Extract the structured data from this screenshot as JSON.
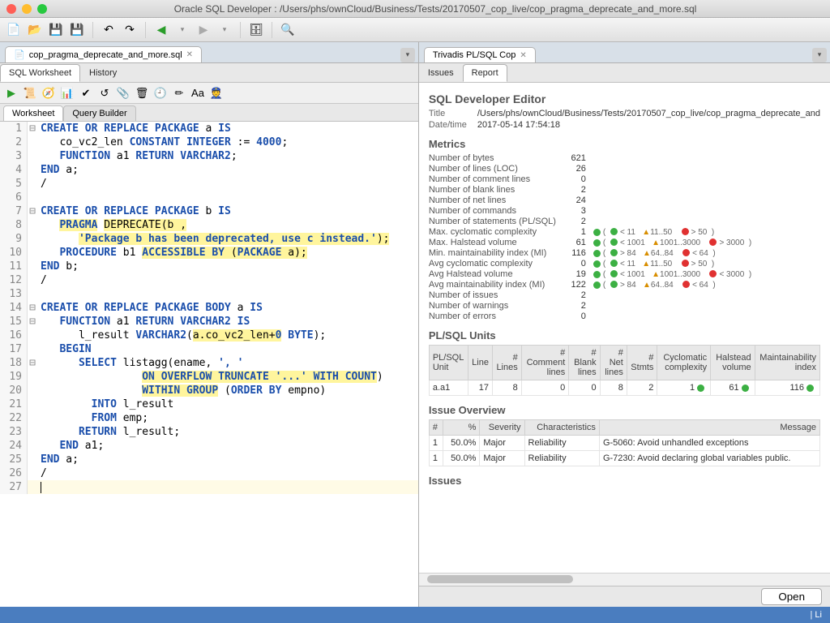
{
  "window": {
    "title": "Oracle SQL Developer : /Users/phs/ownCloud/Business/Tests/20170507_cop_live/cop_pragma_deprecate_and_more.sql"
  },
  "left": {
    "file_tab": "cop_pragma_deprecate_and_more.sql",
    "subtabs": {
      "sql": "SQL Worksheet",
      "history": "History"
    },
    "ws_tabs": {
      "worksheet": "Worksheet",
      "qb": "Query Builder"
    },
    "code": [
      {
        "n": 1,
        "f": "⊟",
        "html": "<span class='kw'>CREATE OR REPLACE PACKAGE</span> a <span class='kw'>IS</span>"
      },
      {
        "n": 2,
        "f": "",
        "html": "   co_vc2_len <span class='kw'>CONSTANT INTEGER</span> := <span class='num'>4000</span>;"
      },
      {
        "n": 3,
        "f": "",
        "html": "   <span class='kw'>FUNCTION</span> a1 <span class='kw'>RETURN VARCHAR2</span>;"
      },
      {
        "n": 4,
        "f": "",
        "html": "<span class='kw'>END</span> a;"
      },
      {
        "n": 5,
        "f": "",
        "html": "/"
      },
      {
        "n": 6,
        "f": "",
        "html": ""
      },
      {
        "n": 7,
        "f": "⊟",
        "html": "<span class='kw'>CREATE OR REPLACE PACKAGE</span> b <span class='kw'>IS</span>"
      },
      {
        "n": 8,
        "f": "",
        "html": "   <span class='hl'><span class='kw'>PRAGMA</span></span> <span class='hl'>DEPRECATE(b ,</span>"
      },
      {
        "n": 9,
        "f": "",
        "html": "      <span class='hl'><span class='str'>'Package b has been deprecated, use c instead.'</span>);</span>"
      },
      {
        "n": 10,
        "f": "",
        "html": "   <span class='kw'>PROCEDURE</span> b1 <span class='hl'><span class='kw'>ACCESSIBLE BY</span> (<span class='kw'>PACKAGE</span> a);</span>"
      },
      {
        "n": 11,
        "f": "",
        "html": "<span class='kw'>END</span> b;"
      },
      {
        "n": 12,
        "f": "",
        "html": "/"
      },
      {
        "n": 13,
        "f": "",
        "html": ""
      },
      {
        "n": 14,
        "f": "⊟",
        "html": "<span class='kw'>CREATE OR REPLACE PACKAGE BODY</span> a <span class='kw'>IS</span>"
      },
      {
        "n": 15,
        "f": "⊟",
        "html": "   <span class='kw'>FUNCTION</span> a1 <span class='kw'>RETURN VARCHAR2 IS</span>"
      },
      {
        "n": 16,
        "f": "",
        "html": "      l_result <span class='kw'>VARCHAR2</span>(<span class='hl'>a.co_vc2_len+<span class='num'>0</span></span> <span class='kw'>BYTE</span>);"
      },
      {
        "n": 17,
        "f": "",
        "html": "   <span class='kw'>BEGIN</span>"
      },
      {
        "n": 18,
        "f": "⊟",
        "html": "      <span class='kw'>SELECT</span> listagg(ename, <span class='str'>', '</span>"
      },
      {
        "n": 19,
        "f": "",
        "html": "                <span class='hl'><span class='kw'>ON OVERFLOW TRUNCATE</span> <span class='str'>'...'</span> <span class='kw'>WITH COUNT</span></span>)"
      },
      {
        "n": 20,
        "f": "",
        "html": "                <span class='hl'><span class='kw'>WITHIN GROUP</span></span> (<span class='kw'>ORDER BY</span> empno)"
      },
      {
        "n": 21,
        "f": "",
        "html": "        <span class='kw'>INTO</span> l_result"
      },
      {
        "n": 22,
        "f": "",
        "html": "        <span class='kw'>FROM</span> emp;"
      },
      {
        "n": 23,
        "f": "",
        "html": "      <span class='kw'>RETURN</span> l_result;"
      },
      {
        "n": 24,
        "f": "",
        "html": "   <span class='kw'>END</span> a1;"
      },
      {
        "n": 25,
        "f": "",
        "html": "<span class='kw'>END</span> a;"
      },
      {
        "n": 26,
        "f": "",
        "html": "/"
      },
      {
        "n": 27,
        "f": "",
        "html": "<span class='cursor'></span>",
        "cur": true
      }
    ]
  },
  "right": {
    "tab_title": "Trivadis PL/SQL Cop",
    "subtabs": {
      "issues": "Issues",
      "report": "Report"
    },
    "report": {
      "heading": "SQL Developer Editor",
      "title_label": "Title",
      "title_value": "/Users/phs/ownCloud/Business/Tests/20170507_cop_live/cop_pragma_deprecate_and",
      "dt_label": "Date/time",
      "dt_value": "2017-05-14 17:54:18",
      "metrics_heading": "Metrics",
      "simple_metrics": [
        {
          "label": "Number of bytes",
          "val": "621"
        },
        {
          "label": "Number of lines (LOC)",
          "val": "26"
        },
        {
          "label": "Number of comment lines",
          "val": "0"
        },
        {
          "label": "Number of blank lines",
          "val": "2"
        },
        {
          "label": "Number of net lines",
          "val": "24"
        },
        {
          "label": "Number of commands",
          "val": "3"
        },
        {
          "label": "Number of statements (PL/SQL)",
          "val": "2"
        }
      ],
      "threshold_metrics": [
        {
          "label": "Max. cyclomatic complexity",
          "val": "1",
          "g": "< 11",
          "y": "11..50",
          "r": "> 50"
        },
        {
          "label": "Max. Halstead volume",
          "val": "61",
          "g": "< 1001",
          "y": "1001..3000",
          "r": "> 3000"
        },
        {
          "label": "Min. maintainability index (MI)",
          "val": "116",
          "g": "> 84",
          "y": "64..84",
          "r": "< 64"
        },
        {
          "label": "Avg cyclomatic complexity",
          "val": "0",
          "g": "< 11",
          "y": "11..50",
          "r": "> 50"
        },
        {
          "label": "Avg Halstead volume",
          "val": "19",
          "g": "< 1001",
          "y": "1001..3000",
          "r": "< 3000"
        },
        {
          "label": "Avg maintainability index (MI)",
          "val": "122",
          "g": "> 84",
          "y": "64..84",
          "r": "< 64"
        }
      ],
      "tail_metrics": [
        {
          "label": "Number of issues",
          "val": "2"
        },
        {
          "label": "Number of warnings",
          "val": "2"
        },
        {
          "label": "Number of errors",
          "val": "0"
        }
      ],
      "units_heading": "PL/SQL Units",
      "units_headers": [
        "PL/SQL Unit",
        "Line",
        "# Lines",
        "# Comment lines",
        "# Blank lines",
        "# Net lines",
        "# Stmts",
        "Cyclomatic complexity",
        "Halstead volume",
        "Maintainability index"
      ],
      "units_row": [
        "a.a1",
        "17",
        "8",
        "0",
        "0",
        "8",
        "2",
        "1",
        "61",
        "116"
      ],
      "issue_ov_heading": "Issue Overview",
      "issue_ov_headers": [
        "#",
        "%",
        "Severity",
        "Characteristics",
        "Message"
      ],
      "issue_ov_rows": [
        [
          "1",
          "50.0%",
          "Major",
          "Reliability",
          "G-5060: Avoid unhandled exceptions"
        ],
        [
          "1",
          "50.0%",
          "Major",
          "Reliability",
          "G-7230: Avoid declaring global variables public."
        ]
      ],
      "issues_heading": "Issues",
      "open_btn": "Open"
    }
  },
  "status": {
    "text": "| Li"
  }
}
